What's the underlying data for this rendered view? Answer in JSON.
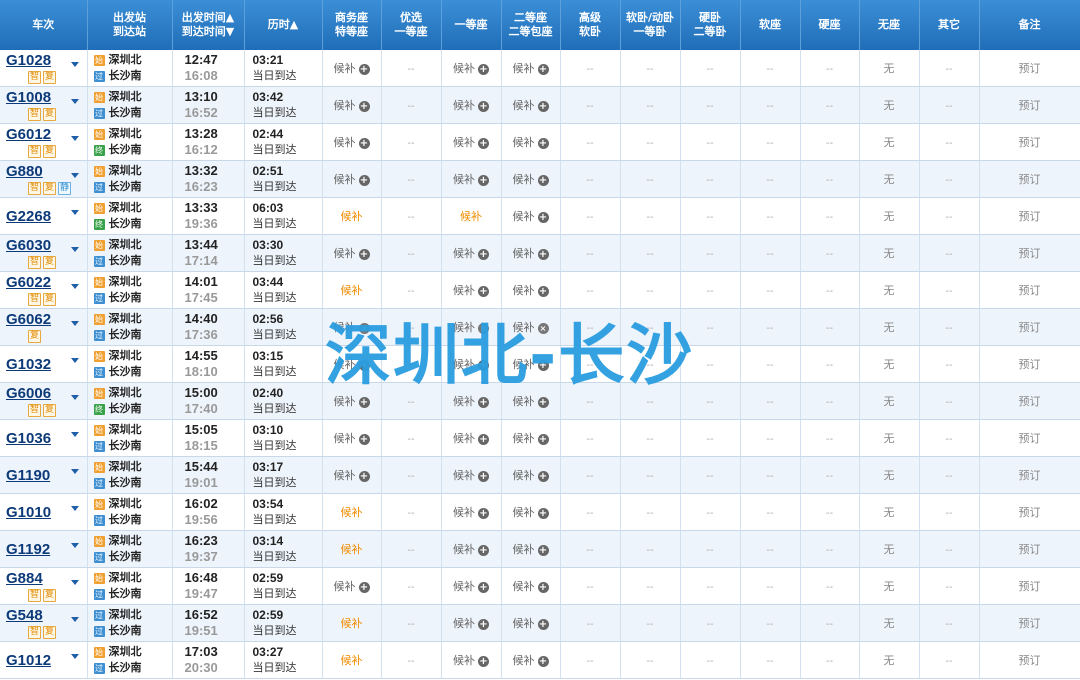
{
  "headers": [
    {
      "l1": "车次",
      "l2": ""
    },
    {
      "l1": "出发站",
      "l2": "到达站"
    },
    {
      "l1": "出发时间▲",
      "l2": "到达时间▼"
    },
    {
      "l1": "历时▲",
      "l2": ""
    },
    {
      "l1": "商务座",
      "l2": "特等座"
    },
    {
      "l1": "优选",
      "l2": "一等座"
    },
    {
      "l1": "一等座",
      "l2": ""
    },
    {
      "l1": "二等座",
      "l2": "二等包座"
    },
    {
      "l1": "高级",
      "l2": "软卧"
    },
    {
      "l1": "软卧/动卧",
      "l2": "一等卧"
    },
    {
      "l1": "硬卧",
      "l2": "二等卧"
    },
    {
      "l1": "软座",
      "l2": ""
    },
    {
      "l1": "硬座",
      "l2": ""
    },
    {
      "l1": "无座",
      "l2": ""
    },
    {
      "l1": "其它",
      "l2": ""
    },
    {
      "l1": "备注",
      "l2": ""
    }
  ],
  "labels": {
    "hb": "候补",
    "dash": "--",
    "none": "无",
    "book": "预订",
    "same_day": "当日到达",
    "from_station": "深圳北",
    "to_station": "长沙南",
    "badge_s": "始",
    "badge_p": "过",
    "badge_e": "终",
    "tag_z": "智",
    "tag_f": "复",
    "tag_j": "静"
  },
  "watermark": "深圳北-长沙",
  "colors": {
    "header_bg": "#2e7fc9",
    "watermark": "#2a9de0",
    "hb_orange": "#f08c00"
  },
  "rows": [
    {
      "train": "G1028",
      "tags": [
        "智",
        "复"
      ],
      "fb": "始",
      "tb": "过",
      "dep": "12:47",
      "arr": "16:08",
      "dur": "03:21",
      "biz": "hb",
      "first": "hb",
      "second": "hb"
    },
    {
      "train": "G1008",
      "tags": [
        "智",
        "复"
      ],
      "fb": "始",
      "tb": "过",
      "dep": "13:10",
      "arr": "16:52",
      "dur": "03:42",
      "biz": "hb",
      "first": "hb",
      "second": "hb"
    },
    {
      "train": "G6012",
      "tags": [
        "智",
        "复"
      ],
      "fb": "始",
      "tb": "终",
      "dep": "13:28",
      "arr": "16:12",
      "dur": "02:44",
      "biz": "hb",
      "first": "hb",
      "second": "hb"
    },
    {
      "train": "G880",
      "tags": [
        "智",
        "复",
        "静"
      ],
      "fb": "始",
      "tb": "过",
      "dep": "13:32",
      "arr": "16:23",
      "dur": "02:51",
      "biz": "hb",
      "first": "hb",
      "second": "hb"
    },
    {
      "train": "G2268",
      "tags": [],
      "fb": "始",
      "tb": "终",
      "dep": "13:33",
      "arr": "19:36",
      "dur": "06:03",
      "biz": "hbo",
      "first": "hbo",
      "second": "hb"
    },
    {
      "train": "G6030",
      "tags": [
        "智",
        "复"
      ],
      "fb": "始",
      "tb": "过",
      "dep": "13:44",
      "arr": "17:14",
      "dur": "03:30",
      "biz": "hb",
      "first": "hb",
      "second": "hb"
    },
    {
      "train": "G6022",
      "tags": [
        "智",
        "复"
      ],
      "fb": "始",
      "tb": "过",
      "dep": "14:01",
      "arr": "17:45",
      "dur": "03:44",
      "biz": "hbo",
      "first": "hb",
      "second": "hb"
    },
    {
      "train": "G6062",
      "tags": [
        "复"
      ],
      "fb": "始",
      "tb": "过",
      "dep": "14:40",
      "arr": "17:36",
      "dur": "02:56",
      "biz": "hbx",
      "first": "hbx",
      "second": "hbx"
    },
    {
      "train": "G1032",
      "tags": [],
      "fb": "始",
      "tb": "过",
      "dep": "14:55",
      "arr": "18:10",
      "dur": "03:15",
      "biz": "hb",
      "first": "hb",
      "second": "hb"
    },
    {
      "train": "G6006",
      "tags": [
        "智",
        "复"
      ],
      "fb": "始",
      "tb": "终",
      "dep": "15:00",
      "arr": "17:40",
      "dur": "02:40",
      "biz": "hb",
      "first": "hb",
      "second": "hb"
    },
    {
      "train": "G1036",
      "tags": [],
      "fb": "始",
      "tb": "过",
      "dep": "15:05",
      "arr": "18:15",
      "dur": "03:10",
      "biz": "hb",
      "first": "hb",
      "second": "hb"
    },
    {
      "train": "G1190",
      "tags": [],
      "fb": "始",
      "tb": "过",
      "dep": "15:44",
      "arr": "19:01",
      "dur": "03:17",
      "biz": "hb",
      "first": "hb",
      "second": "hb"
    },
    {
      "train": "G1010",
      "tags": [],
      "fb": "始",
      "tb": "过",
      "dep": "16:02",
      "arr": "19:56",
      "dur": "03:54",
      "biz": "hbo",
      "first": "hb",
      "second": "hb"
    },
    {
      "train": "G1192",
      "tags": [],
      "fb": "始",
      "tb": "过",
      "dep": "16:23",
      "arr": "19:37",
      "dur": "03:14",
      "biz": "hbo",
      "first": "hb",
      "second": "hb"
    },
    {
      "train": "G884",
      "tags": [
        "智",
        "复"
      ],
      "fb": "始",
      "tb": "过",
      "dep": "16:48",
      "arr": "19:47",
      "dur": "02:59",
      "biz": "hb",
      "first": "hb",
      "second": "hb"
    },
    {
      "train": "G548",
      "tags": [
        "智",
        "复"
      ],
      "fb": "过",
      "tb": "过",
      "dep": "16:52",
      "arr": "19:51",
      "dur": "02:59",
      "biz": "hbo",
      "first": "hb",
      "second": "hb"
    },
    {
      "train": "G1012",
      "tags": [],
      "fb": "始",
      "tb": "过",
      "dep": "17:03",
      "arr": "20:30",
      "dur": "03:27",
      "biz": "hbo",
      "first": "hb",
      "second": "hb"
    }
  ]
}
